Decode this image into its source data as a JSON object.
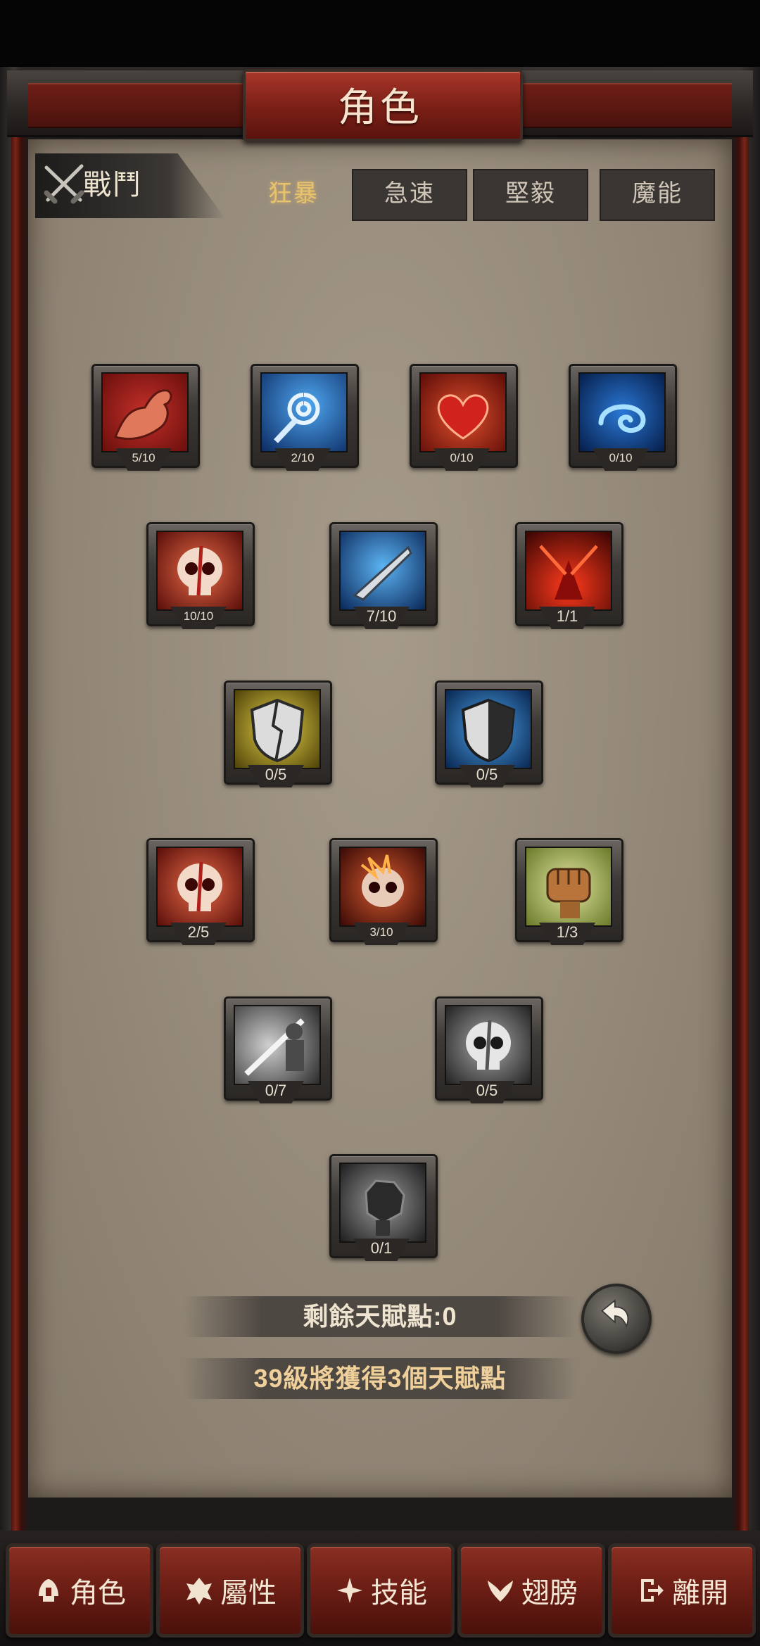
{
  "window": {
    "title": "角色"
  },
  "category": {
    "label": "戰鬥",
    "icon": "crossed-swords-icon"
  },
  "tabs": [
    {
      "label": "狂暴",
      "active": true
    },
    {
      "label": "急速",
      "active": false
    },
    {
      "label": "堅毅",
      "active": false
    },
    {
      "label": "魔能",
      "active": false
    }
  ],
  "talents": [
    {
      "icon": "muscle-arm-icon",
      "level": "5/10"
    },
    {
      "icon": "ice-spiral-spear-icon",
      "level": "2/10"
    },
    {
      "icon": "red-heart-icon",
      "level": "0/10"
    },
    {
      "icon": "blue-swirl-icon",
      "level": "0/10"
    },
    {
      "icon": "bleeding-skull-icon",
      "level": "10/10"
    },
    {
      "icon": "ice-blade-icon",
      "level": "7/10"
    },
    {
      "icon": "red-demon-icon",
      "level": "1/1"
    },
    {
      "icon": "gold-cracked-shield-icon",
      "level": "0/5"
    },
    {
      "icon": "blue-split-shield-icon",
      "level": "0/5"
    },
    {
      "icon": "red-skull-icon",
      "level": "2/5"
    },
    {
      "icon": "burning-skull-icon",
      "level": "3/10"
    },
    {
      "icon": "fist-icon",
      "level": "1/3"
    },
    {
      "icon": "gray-sword-strike-icon",
      "level": "0/7"
    },
    {
      "icon": "gray-skull-icon",
      "level": "0/5"
    },
    {
      "icon": "gray-fist-icon",
      "level": "0/1"
    }
  ],
  "info": {
    "remaining_points": "剩餘天賦點:0",
    "next_reward": "39級將獲得3個天賦點"
  },
  "undo_icon": "undo-arrow-icon",
  "bottom_nav": [
    {
      "label": "角色",
      "icon": "helmet-icon"
    },
    {
      "label": "屬性",
      "icon": "attribute-emblem-icon"
    },
    {
      "label": "技能",
      "icon": "skill-emblem-icon"
    },
    {
      "label": "翅膀",
      "icon": "wings-icon"
    },
    {
      "label": "離開",
      "icon": "exit-icon"
    }
  ],
  "colors": {
    "tab_active": "#e8c26d",
    "remaining_text": "#efe4d0",
    "next_reward_text": "#f0d09a"
  }
}
